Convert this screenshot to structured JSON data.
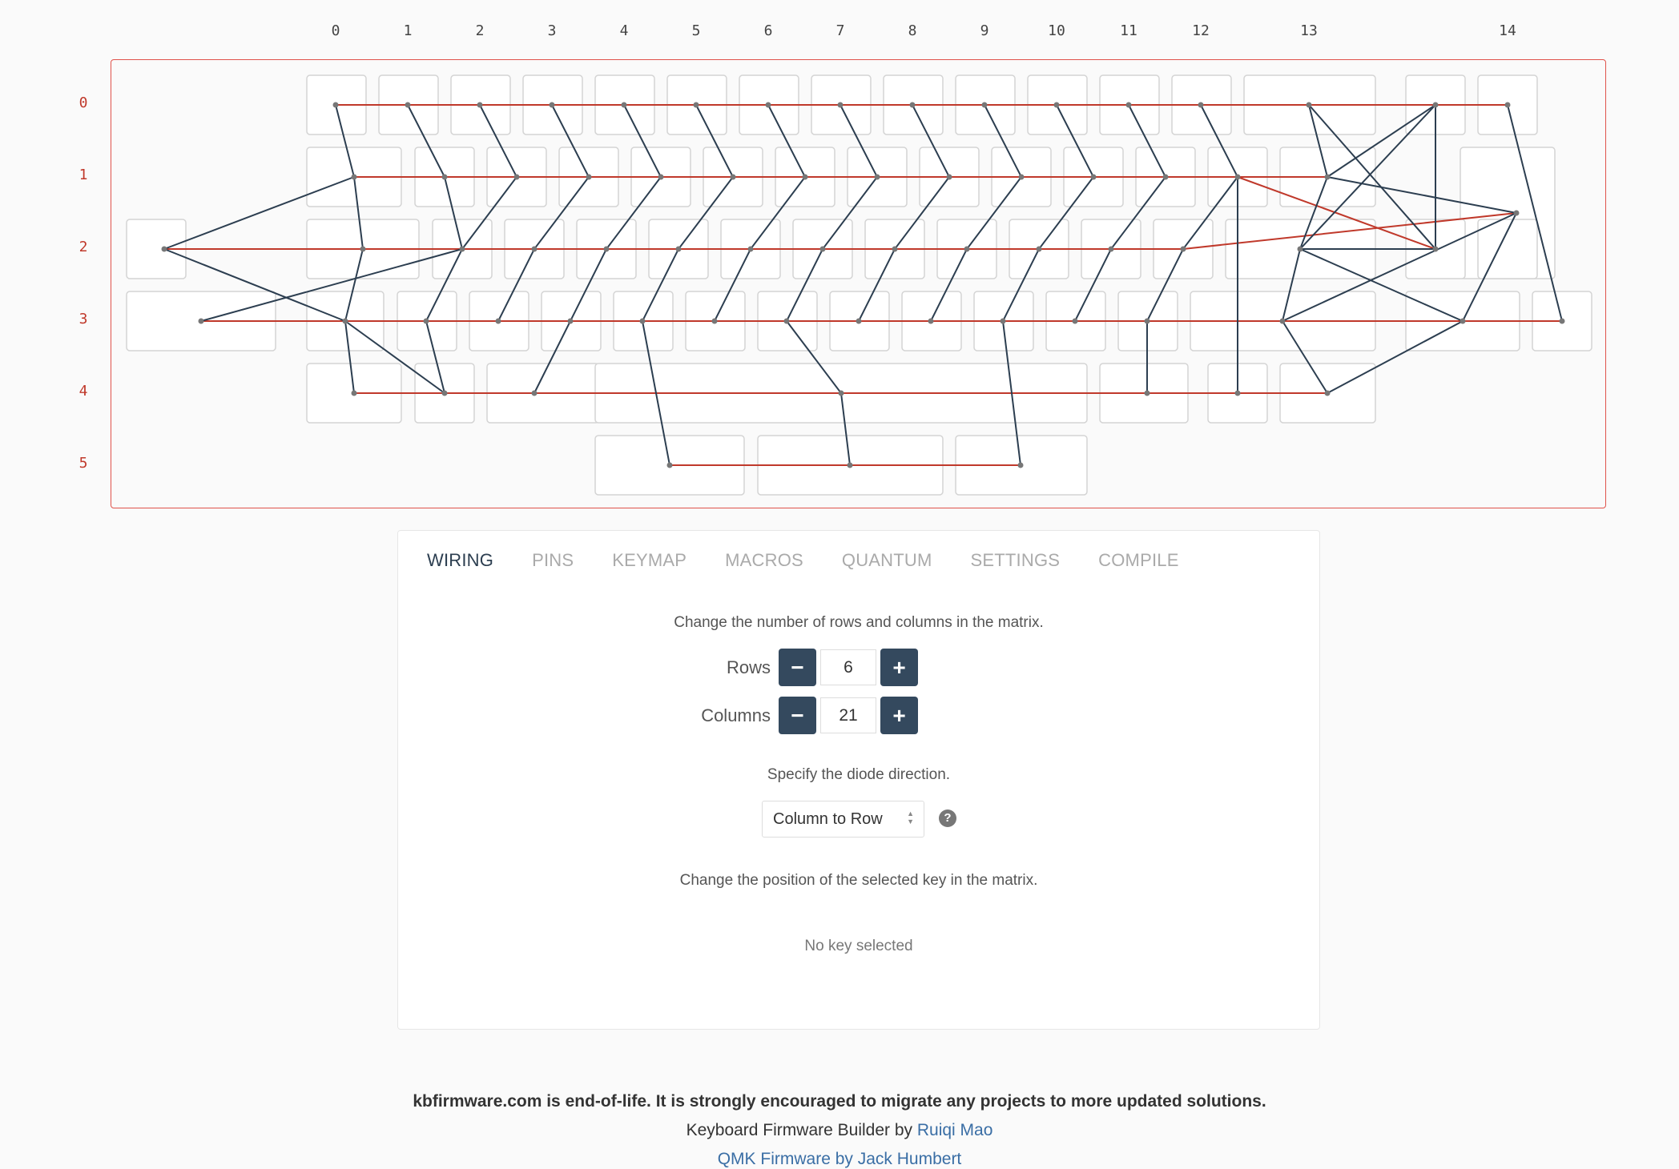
{
  "matrix": {
    "column_labels": [
      "0",
      "1",
      "2",
      "3",
      "4",
      "5",
      "6",
      "7",
      "8",
      "9",
      "10",
      "11",
      "12",
      "13",
      "14"
    ],
    "row_labels": [
      "0",
      "1",
      "2",
      "3",
      "4",
      "5"
    ],
    "colors": {
      "row_wire": "#c0392b",
      "col_wire": "#2c3e50",
      "key_border": "#d4d4d4",
      "node": "#777777"
    }
  },
  "tabs": [
    {
      "label": "WIRING",
      "active": true
    },
    {
      "label": "PINS",
      "active": false
    },
    {
      "label": "KEYMAP",
      "active": false
    },
    {
      "label": "MACROS",
      "active": false
    },
    {
      "label": "QUANTUM",
      "active": false
    },
    {
      "label": "SETTINGS",
      "active": false
    },
    {
      "label": "COMPILE",
      "active": false
    }
  ],
  "wiring": {
    "matrix_size_text": "Change the number of rows and columns in the matrix.",
    "rows_label": "Rows",
    "rows_value": "6",
    "columns_label": "Columns",
    "columns_value": "21",
    "minus_symbol": "−",
    "plus_symbol": "+",
    "diode_text": "Specify the diode direction.",
    "diode_value": "Column to Row",
    "help_symbol": "?",
    "position_text": "Change the position of the selected key in the matrix.",
    "no_key_text": "No key selected"
  },
  "footer": {
    "eol_notice": "kbfirmware.com is end-of-life. It is strongly encouraged to migrate any projects to more updated solutions.",
    "credit_prefix": "Keyboard Firmware Builder by ",
    "credit_author": "Ruiqi Mao",
    "partial_line": "QMK Firmware by Jack Humbert"
  }
}
